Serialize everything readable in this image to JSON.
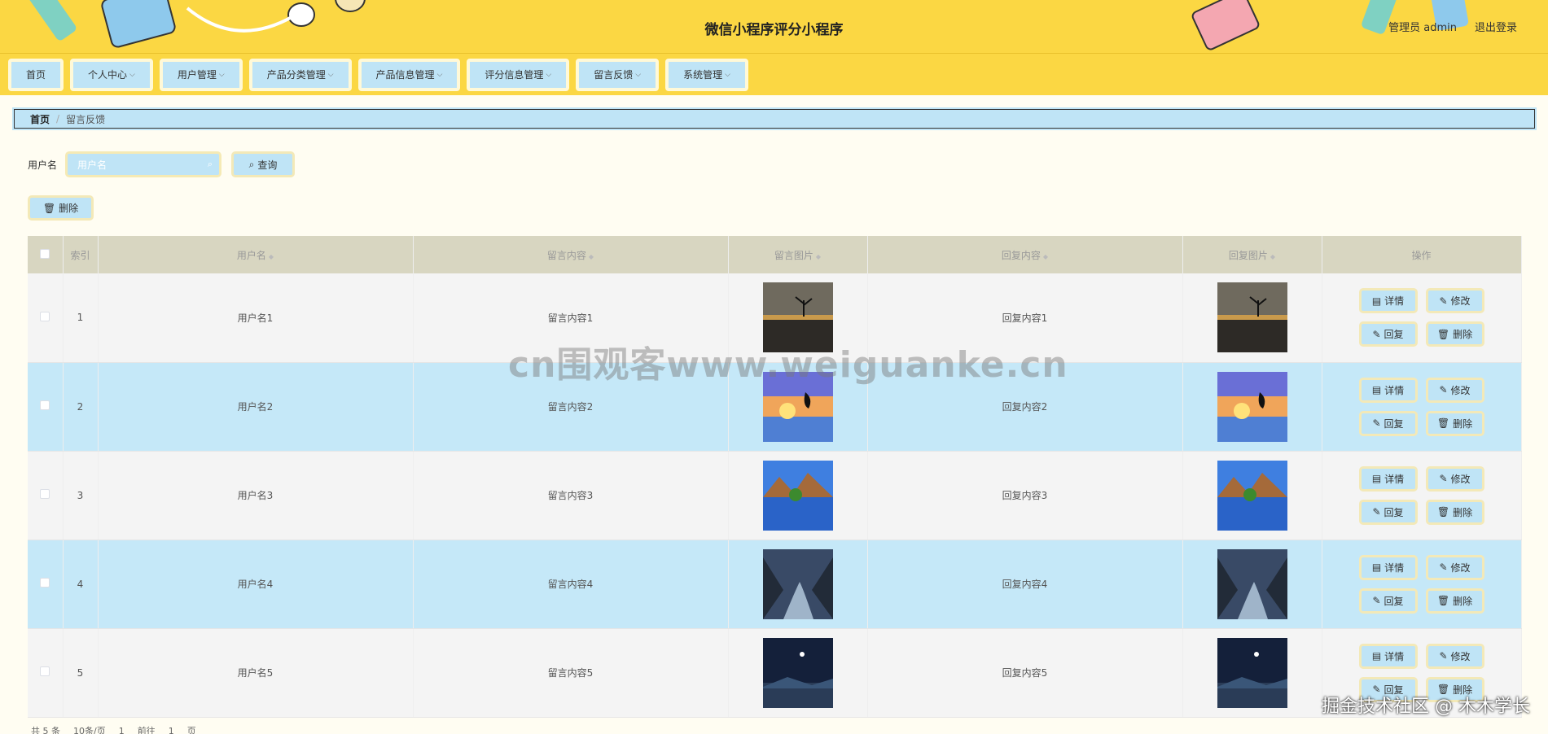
{
  "header": {
    "title": "微信小程序评分小程序",
    "admin": "管理员 admin",
    "logout": "退出登录"
  },
  "nav": [
    {
      "label": "首页",
      "has_dropdown": false
    },
    {
      "label": "个人中心",
      "has_dropdown": true
    },
    {
      "label": "用户管理",
      "has_dropdown": true
    },
    {
      "label": "产品分类管理",
      "has_dropdown": true
    },
    {
      "label": "产品信息管理",
      "has_dropdown": true
    },
    {
      "label": "评分信息管理",
      "has_dropdown": true
    },
    {
      "label": "留言反馈",
      "has_dropdown": true
    },
    {
      "label": "系统管理",
      "has_dropdown": true
    }
  ],
  "breadcrumb": {
    "home": "首页",
    "separator": "/",
    "current": "留言反馈"
  },
  "search": {
    "label": "用户名",
    "placeholder": "用户名",
    "button": "查询"
  },
  "toolbar": {
    "delete_label": "删除"
  },
  "table": {
    "columns": [
      "索引",
      "用户名",
      "留言内容",
      "留言图片",
      "回复内容",
      "回复图片",
      "操作"
    ],
    "rows": [
      {
        "index": "1",
        "username": "用户名1",
        "content": "留言内容1",
        "image": "lone-tree-lake-sunset",
        "reply": "回复内容1",
        "reply_image": "lone-tree-lake-sunset"
      },
      {
        "index": "2",
        "username": "用户名2",
        "content": "留言内容2",
        "image": "dolphin-sunset",
        "reply": "回复内容2",
        "reply_image": "dolphin-sunset"
      },
      {
        "index": "3",
        "username": "用户名3",
        "content": "留言内容3",
        "image": "mountain-lake-reflection",
        "reply": "回复内容3",
        "reply_image": "mountain-lake-reflection"
      },
      {
        "index": "4",
        "username": "用户名4",
        "content": "留言内容4",
        "image": "canyon-river",
        "reply": "回复内容4",
        "reply_image": "canyon-river"
      },
      {
        "index": "5",
        "username": "用户名5",
        "content": "留言内容5",
        "image": "night-sky-landscape",
        "reply": "回复内容5",
        "reply_image": "night-sky-landscape"
      }
    ],
    "actions": {
      "detail": "详情",
      "edit": "修改",
      "reply": "回复",
      "delete": "删除"
    }
  },
  "pager": {
    "total": "共 5 条",
    "page_size": "10条/页",
    "page": "1",
    "goto": "前往",
    "goto_value": "1",
    "goto_unit": "页"
  },
  "watermarks": {
    "center": "cn围观客www.weiguanke.cn",
    "corner": "掘金技术社区 @ 木木学长"
  },
  "colors": {
    "header_yellow": "#fbd743",
    "light_blue": "#bfe4f6",
    "row_blue": "#c5e8f8",
    "header_gray": "#d8d6c1"
  }
}
